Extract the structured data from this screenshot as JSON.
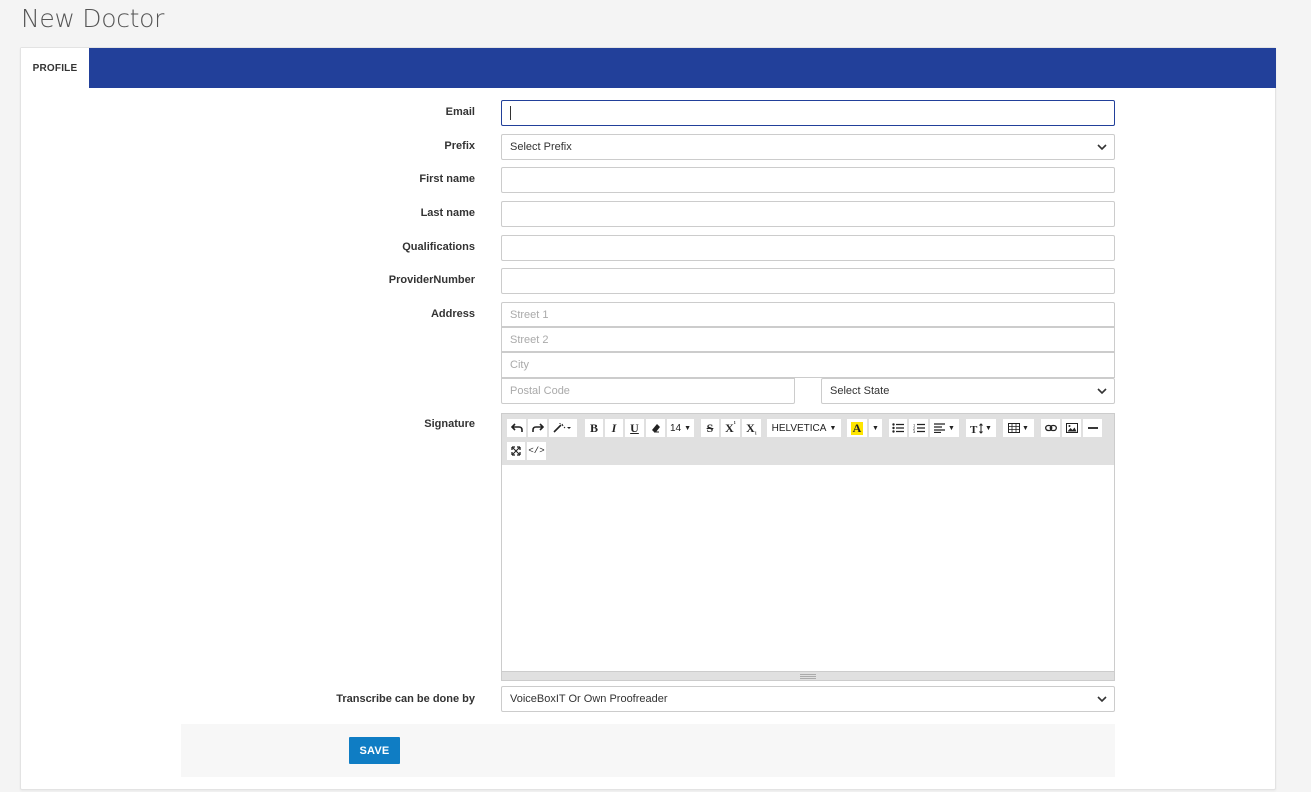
{
  "page": {
    "title": "New Doctor"
  },
  "tabs": [
    {
      "label": "PROFILE",
      "active": true
    }
  ],
  "form": {
    "email": {
      "label": "Email",
      "value": ""
    },
    "prefix": {
      "label": "Prefix",
      "selected": "Select Prefix"
    },
    "first_name": {
      "label": "First name",
      "value": ""
    },
    "last_name": {
      "label": "Last name",
      "value": ""
    },
    "qualifications": {
      "label": "Qualifications",
      "value": ""
    },
    "provider_number": {
      "label": "ProviderNumber",
      "value": ""
    },
    "address": {
      "label": "Address",
      "street1_placeholder": "Street 1",
      "street2_placeholder": "Street 2",
      "city_placeholder": "City",
      "postal_placeholder": "Postal Code",
      "state_selected": "Select State"
    },
    "signature": {
      "label": "Signature",
      "toolbar": {
        "font_size": "14",
        "font_name": "HELVETICA",
        "text_color_letter": "A",
        "bold": "B",
        "italic": "I",
        "underline": "U",
        "strike": "S",
        "superscript": "X",
        "subscript": "X",
        "code": "</>"
      }
    },
    "transcribe": {
      "label": "Transcribe can be done by",
      "selected": "VoiceBoxIT Or Own Proofreader"
    }
  },
  "actions": {
    "save_label": "SAVE"
  },
  "colors": {
    "tab_bar": "#22409a",
    "save_button": "#0f7dc4",
    "page_bg": "#f4f4f4",
    "highlight": "#ffe600"
  }
}
